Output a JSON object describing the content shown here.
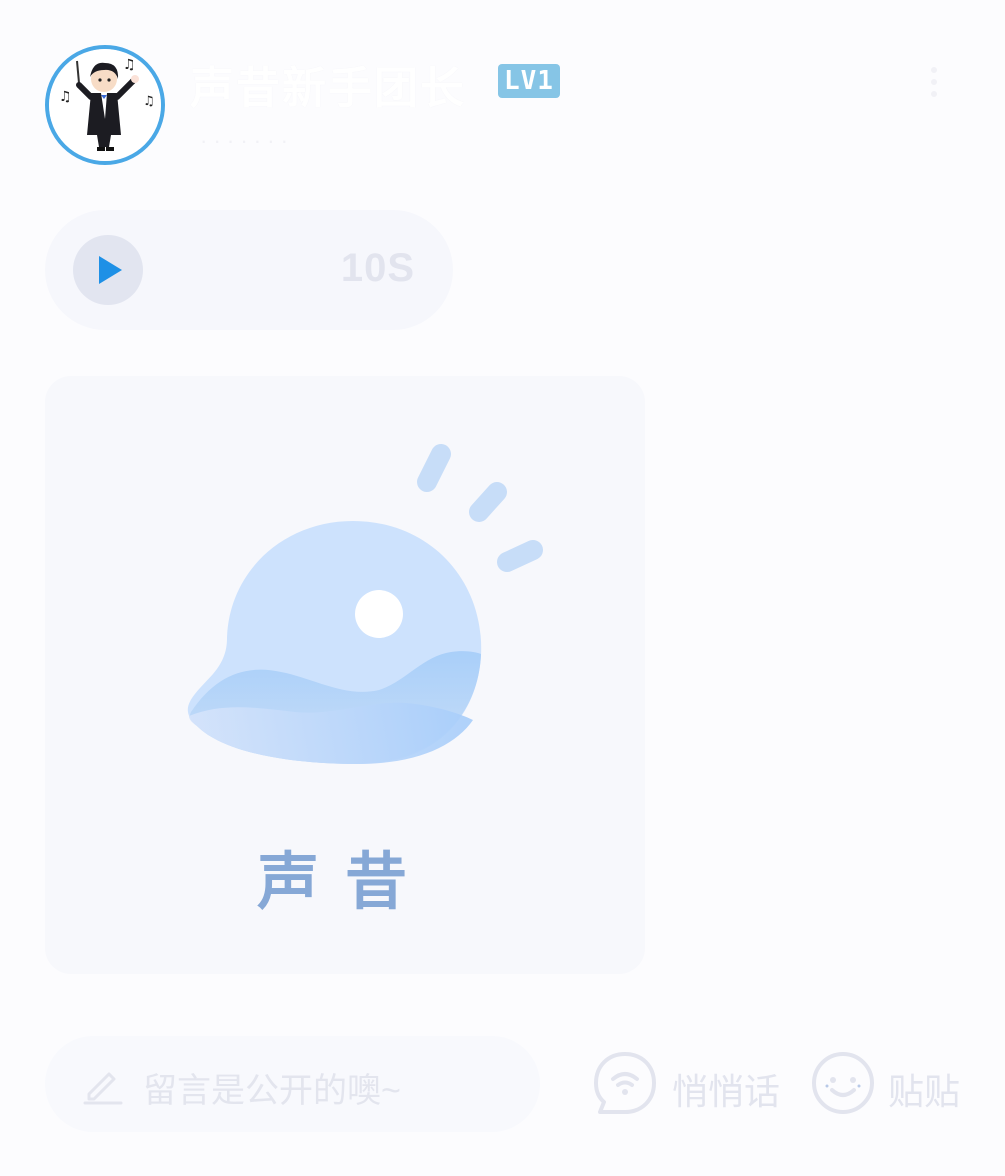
{
  "user": {
    "name": "声昔新手团长",
    "level": "LV1",
    "sub_info": "· · · · · · ·"
  },
  "audio": {
    "duration": "10S"
  },
  "image_card": {
    "brand": "声昔"
  },
  "comment": {
    "placeholder": "留言是公开的噢~"
  },
  "actions": {
    "whisper_label": "悄悄话",
    "sticker_label": "贴贴"
  },
  "colors": {
    "accent": "#1e90e6",
    "brand_blue": "#86a8d6",
    "avatar_ring": "#4aa8e6",
    "level_badge": "#86c5e6"
  },
  "icons": {
    "more": "more-vertical-icon",
    "play": "play-icon",
    "pencil": "pencil-icon",
    "whisper": "whisper-bubble-icon",
    "sticker": "smiley-icon"
  }
}
